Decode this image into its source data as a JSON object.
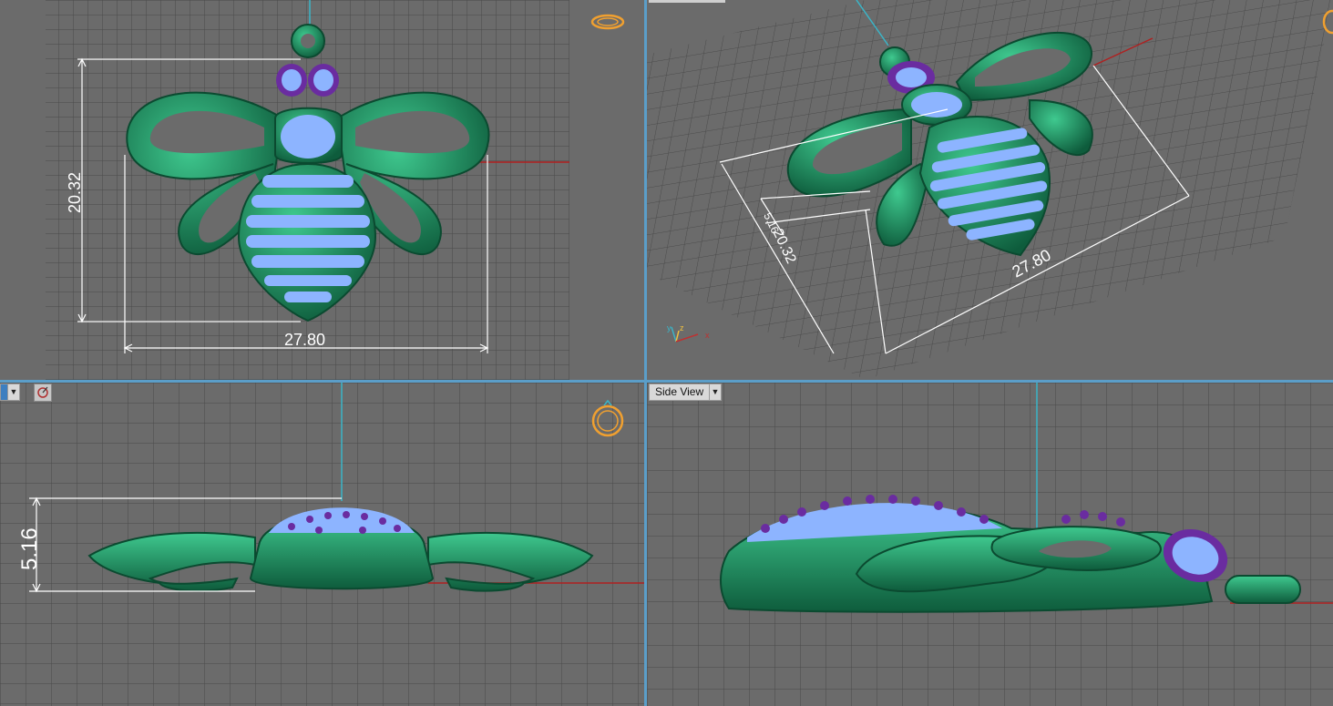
{
  "viewports": {
    "top_view": {
      "dim_height": "20.32",
      "dim_width": "27.80"
    },
    "perspective": {
      "dim_depth": "5.16",
      "dim_height": "20.32",
      "dim_width": "27.80",
      "axis_labels": {
        "y": "y",
        "z": "z",
        "x": "x"
      }
    },
    "front_view": {
      "dim_height": "5.16"
    },
    "side_view": {
      "label": "Side View",
      "dropdown": "▼"
    }
  },
  "colors": {
    "grid_bg": "#6b6b6b",
    "grid_line": "#4a4a4a",
    "model_green": "#1f8a5f",
    "gem_purple": "#6a2ca0",
    "gem_light": "#8db4ff",
    "separator": "#5b9ec9",
    "ring_icon": "#f0a030"
  }
}
